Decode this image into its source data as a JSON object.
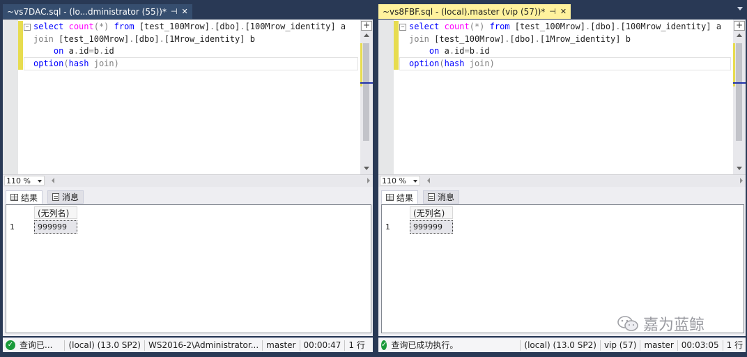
{
  "left": {
    "tab_title": "~vs7DAC.sql - (lo...dministrator (55))*",
    "pin": "⊣",
    "close": "✕",
    "code": {
      "line1": {
        "select": "select",
        "count": "count",
        "star": "(*)",
        "from": "from",
        "table1": "[test_100Mrow]",
        "dot1": ".",
        "schema1": "[dbo]",
        "dot2": ".",
        "obj1": "[100Mrow_identity]",
        "alias1": "a"
      },
      "line2": {
        "join": "join",
        "table2": "[test_100Mrow]",
        "dot1": ".",
        "schema2": "[dbo]",
        "dot2": ".",
        "obj2": "[1Mrow_identity]",
        "alias2": "b"
      },
      "line3": {
        "on": "on",
        "lhs": "a",
        "dot1": ".",
        "col1": "id",
        "eq": "=",
        "rhs": "b",
        "dot2": ".",
        "col2": "id"
      },
      "line4": {
        "option": "option",
        "paren_open": "(",
        "hash": "hash",
        "join": "join",
        "paren_close": ")"
      }
    },
    "zoom": "110 %",
    "result_tabs": {
      "results": "结果",
      "messages": "消息"
    },
    "grid": {
      "column": "(无列名)",
      "row_number": "1",
      "value": "999999"
    },
    "status": {
      "message": "查询已...",
      "server": "(local) (13.0 SP2)",
      "login": "WS2016-2\\Administrator...",
      "database": "master",
      "elapsed": "00:00:47",
      "rows": "1 行"
    }
  },
  "right": {
    "tab_title": "~vs8FBF.sql - (local).master (vip (57))*",
    "pin": "⊣",
    "close": "✕",
    "code": {
      "line1": {
        "select": "select",
        "count": "count",
        "star": "(*)",
        "from": "from",
        "table1": "[test_100Mrow]",
        "dot1": ".",
        "schema1": "[dbo]",
        "dot2": ".",
        "obj1": "[100Mrow_identity]",
        "alias1": "a"
      },
      "line2": {
        "join": "join",
        "table2": "[test_100Mrow]",
        "dot1": ".",
        "schema2": "[dbo]",
        "dot2": ".",
        "obj2": "[1Mrow_identity]",
        "alias2": "b"
      },
      "line3": {
        "on": "on",
        "lhs": "a",
        "dot1": ".",
        "col1": "id",
        "eq": "=",
        "rhs": "b",
        "dot2": ".",
        "col2": "id"
      },
      "line4": {
        "option": "option",
        "paren_open": "(",
        "hash": "hash",
        "join": "join",
        "paren_close": ")"
      }
    },
    "zoom": "110 %",
    "result_tabs": {
      "results": "结果",
      "messages": "消息"
    },
    "grid": {
      "column": "(无列名)",
      "row_number": "1",
      "value": "999999"
    },
    "status": {
      "message": "查询已成功执行。",
      "server": "(local) (13.0 SP2)",
      "login": "vip (57)",
      "database": "master",
      "elapsed": "00:03:05",
      "rows": "1 行"
    }
  },
  "watermark": {
    "text": "嘉为蓝鲸",
    "icon": "wechat-icon"
  },
  "colors": {
    "keyword": "#0000ff",
    "function": "#ff00ff",
    "operator": "#808080",
    "active_tab": "#fff29d",
    "chrome": "#293955",
    "success": "#1a9a3a"
  }
}
